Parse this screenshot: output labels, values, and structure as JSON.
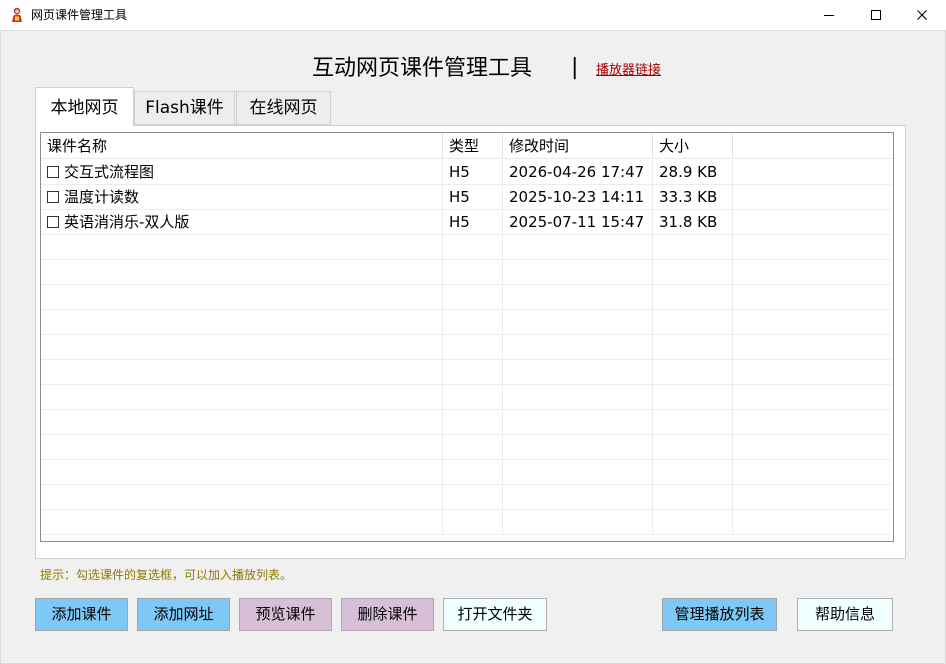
{
  "window": {
    "title": "网页课件管理工具",
    "icon": "red-character-icon",
    "controls": [
      "minimize-icon",
      "maximize-icon",
      "close-icon"
    ]
  },
  "header": {
    "title": "互动网页课件管理工具",
    "separator": "|",
    "player_link": "播放器链接"
  },
  "tabs": [
    {
      "label": "本地网页",
      "active": true
    },
    {
      "label": "Flash课件",
      "active": false
    },
    {
      "label": "在线网页",
      "active": false
    }
  ],
  "table": {
    "columns": [
      "课件名称",
      "类型",
      "修改时间",
      "大小"
    ],
    "rows": [
      {
        "name": "交互式流程图",
        "type": "H5",
        "modified": "2026-04-26 17:47",
        "size": "28.9 KB",
        "checked": false
      },
      {
        "name": "温度计读数",
        "type": "H5",
        "modified": "2025-10-23 14:11",
        "size": "33.3 KB",
        "checked": false
      },
      {
        "name": "英语消消乐-双人版",
        "type": "H5",
        "modified": "2025-07-11 15:47",
        "size": "31.8 KB",
        "checked": false
      }
    ]
  },
  "hint": "提示：勾选课件的复选框，可以加入播放列表。",
  "buttons": {
    "add_course": "添加课件",
    "add_url": "添加网址",
    "preview": "预览课件",
    "delete": "删除课件",
    "open_folder": "打开文件夹",
    "manage_playlist": "管理播放列表",
    "help": "帮助信息"
  },
  "colors": {
    "button_blue": "#7ec8f5",
    "button_pink": "#d8bfd8",
    "button_ice": "#f0ffff",
    "link": "#a00000",
    "hint": "#8a7b00"
  }
}
